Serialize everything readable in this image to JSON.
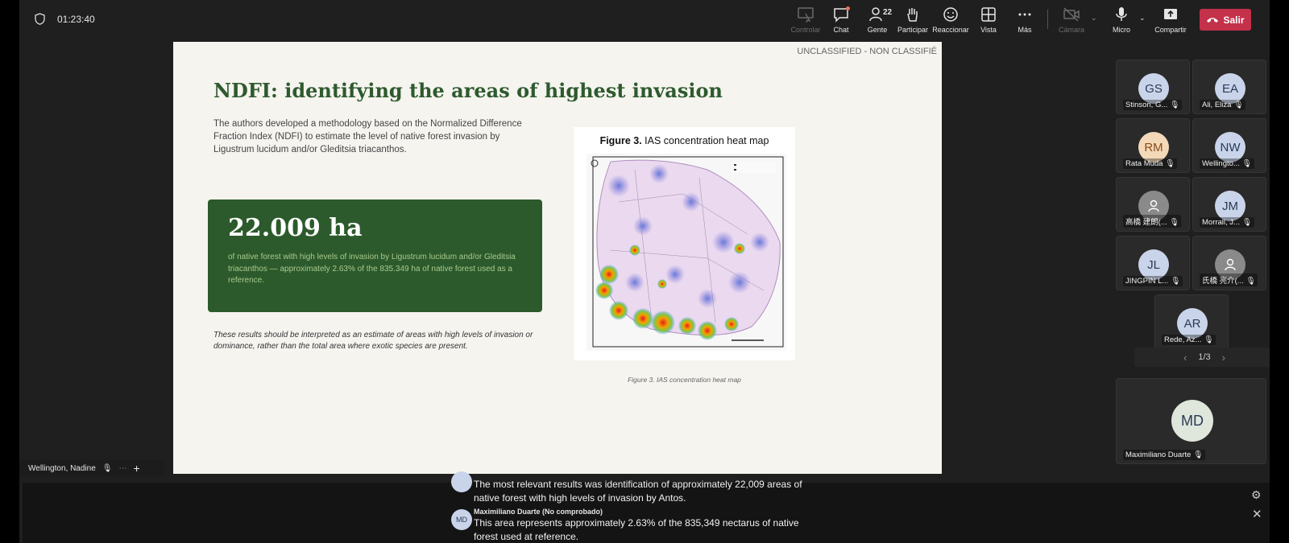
{
  "call": {
    "timer": "01:23:40"
  },
  "toolbar": {
    "controlar": "Controlar",
    "chat": "Chat",
    "gente": "Gente",
    "gente_count": "22",
    "participar": "Participar",
    "reaccionar": "Reaccionar",
    "vista": "Vista",
    "mas": "Más",
    "camara": "Cámara",
    "micro": "Micro",
    "compartir": "Compartir",
    "salir": "Salir"
  },
  "slide": {
    "classification": "UNCLASSIFIED - NON CLASSIFIÉ",
    "title": "NDFI: identifying the areas of highest invasion",
    "intro": "The authors developed a methodology based on the Normalized Difference Fraction Index (NDFI) to estimate the level of native forest invasion by Ligustrum lucidum and/or Gleditsia triacanthos.",
    "stat_value": "22.009 ha",
    "stat_desc": "of native forest with high levels of invasion by Ligustrum lucidum and/or Gleditsia triacanthos — approximately 2.63% of the 835.349 ha of native forest used as a reference.",
    "note": "These results should be interpreted as an estimate of areas with high levels of invasion or dominance, rather than the total area where exotic species are present.",
    "figure_title_bold": "Figure 3.",
    "figure_title_rest": " IAS concentration heat map",
    "figure_caption": "Figure 3. IAS concentration heat map"
  },
  "participants": [
    {
      "initials": "GS",
      "name": "Stinson, G...",
      "color": "#c9d4ea"
    },
    {
      "initials": "EA",
      "name": "Ali, Eliza",
      "color": "#c9d4ea"
    },
    {
      "initials": "RM",
      "name": "Rata Muda",
      "color": "#f3d9b8"
    },
    {
      "initials": "NW",
      "name": "Wellingto...",
      "color": "#c9d4ea"
    },
    {
      "initials": "",
      "name": "高橋 建朗(...",
      "color": "#8a8a8a"
    },
    {
      "initials": "JM",
      "name": "Morrall, J...",
      "color": "#c9d4ea"
    },
    {
      "initials": "JL",
      "name": "JINGPIN L...",
      "color": "#c9d4ea"
    },
    {
      "initials": "",
      "name": "氏橋 亮介(...",
      "color": "#8a8a8a"
    },
    {
      "initials": "AR",
      "name": "Rede, Az...",
      "color": "#c9d4ea"
    }
  ],
  "pager": "1/3",
  "self": {
    "initials": "MD",
    "name": "Maximiliano Duarte"
  },
  "presenter": "Wellington, Nadine",
  "captions": {
    "line1": "The most relevant results was identification of approximately 22,009 areas of",
    "line2": "native forest with high levels of invasion by Antos.",
    "speaker": "Maximiliano Duarte (No comprobado)",
    "speaker_initials": "MD",
    "line3": "This area represents approximately 2.63% of the 835,349 nectarus of native",
    "line4": "forest used at reference."
  }
}
